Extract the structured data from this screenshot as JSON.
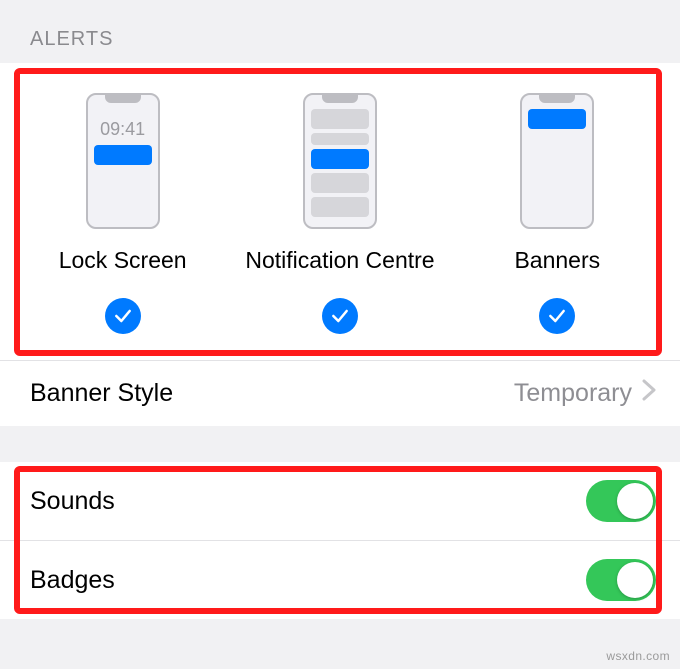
{
  "section_header": "ALERTS",
  "alert_options": {
    "lock_screen": {
      "label": "Lock Screen",
      "time": "09:41",
      "checked": true
    },
    "notification_centre": {
      "label": "Notification Centre",
      "checked": true
    },
    "banners": {
      "label": "Banners",
      "checked": true
    }
  },
  "banner_style": {
    "label": "Banner Style",
    "value": "Temporary"
  },
  "sounds": {
    "label": "Sounds",
    "enabled": true
  },
  "badges": {
    "label": "Badges",
    "enabled": true
  },
  "watermark": "wsxdn.com"
}
